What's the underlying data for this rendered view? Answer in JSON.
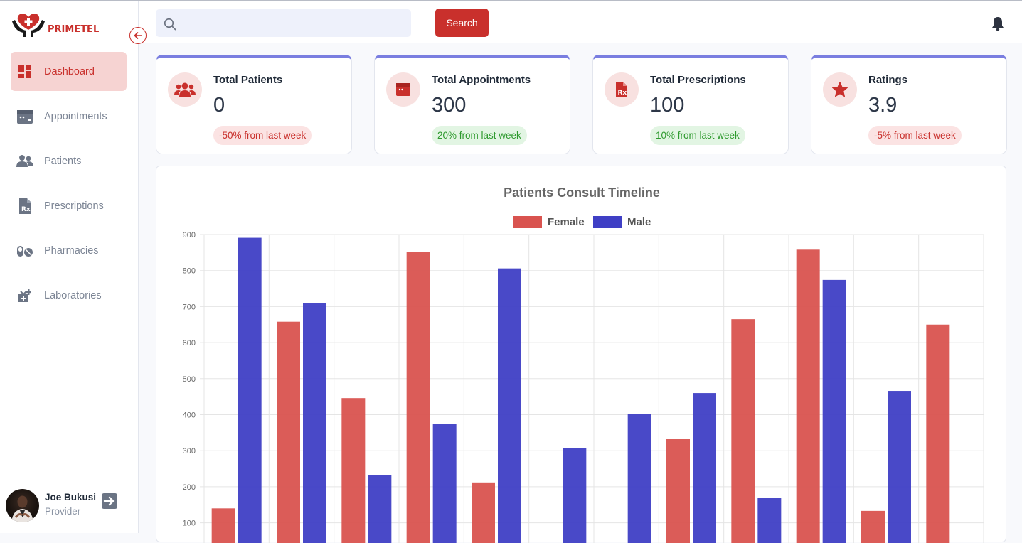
{
  "brand": {
    "name": "PRIMETEL"
  },
  "sidebar": {
    "items": [
      {
        "label": "Dashboard",
        "icon": "dashboard-icon",
        "active": true
      },
      {
        "label": "Appointments",
        "icon": "calendar-icon",
        "active": false
      },
      {
        "label": "Patients",
        "icon": "users-icon",
        "active": false
      },
      {
        "label": "Prescriptions",
        "icon": "prescription-icon",
        "active": false
      },
      {
        "label": "Pharmacies",
        "icon": "pills-icon",
        "active": false
      },
      {
        "label": "Laboratories",
        "icon": "lab-icon",
        "active": false
      }
    ],
    "user": {
      "name": "Joe Bukusi",
      "role": "Provider"
    }
  },
  "topbar": {
    "search_placeholder": "",
    "search_button": "Search"
  },
  "stats": [
    {
      "title": "Total Patients",
      "value": "0",
      "change": "-50% from last week",
      "trend": "down",
      "icon": "users-icon"
    },
    {
      "title": "Total Appointments",
      "value": "300",
      "change": "20% from last week",
      "trend": "up",
      "icon": "calendar-icon"
    },
    {
      "title": "Total Prescriptions",
      "value": "100",
      "change": "10% from last week",
      "trend": "up",
      "icon": "prescription-icon"
    },
    {
      "title": "Ratings",
      "value": "3.9",
      "change": "-5% from last week",
      "trend": "down",
      "icon": "star-icon"
    }
  ],
  "colors": {
    "accent": "#c9302c",
    "card_top": "#7a7ee0",
    "female": "#d9534f",
    "male": "#3f3fc5"
  },
  "chart_data": {
    "type": "bar",
    "title": "Patients Consult Timeline",
    "ylim": [
      100,
      900
    ],
    "yticks": [
      100,
      200,
      300,
      400,
      500,
      600,
      700,
      800,
      900
    ],
    "categories": [
      "",
      "",
      "",
      "",
      "",
      "",
      "",
      "",
      "",
      "",
      "",
      ""
    ],
    "series": [
      {
        "name": "Female",
        "color": "#d9534f",
        "values": [
          140,
          658,
          446,
          852,
          212,
          null,
          null,
          332,
          665,
          858,
          133,
          650
        ]
      },
      {
        "name": "Male",
        "color": "#3f3fc5",
        "values": [
          891,
          710,
          232,
          374,
          806,
          307,
          401,
          460,
          169,
          774,
          466,
          null
        ]
      }
    ],
    "legend": "top-center",
    "grid": true
  }
}
